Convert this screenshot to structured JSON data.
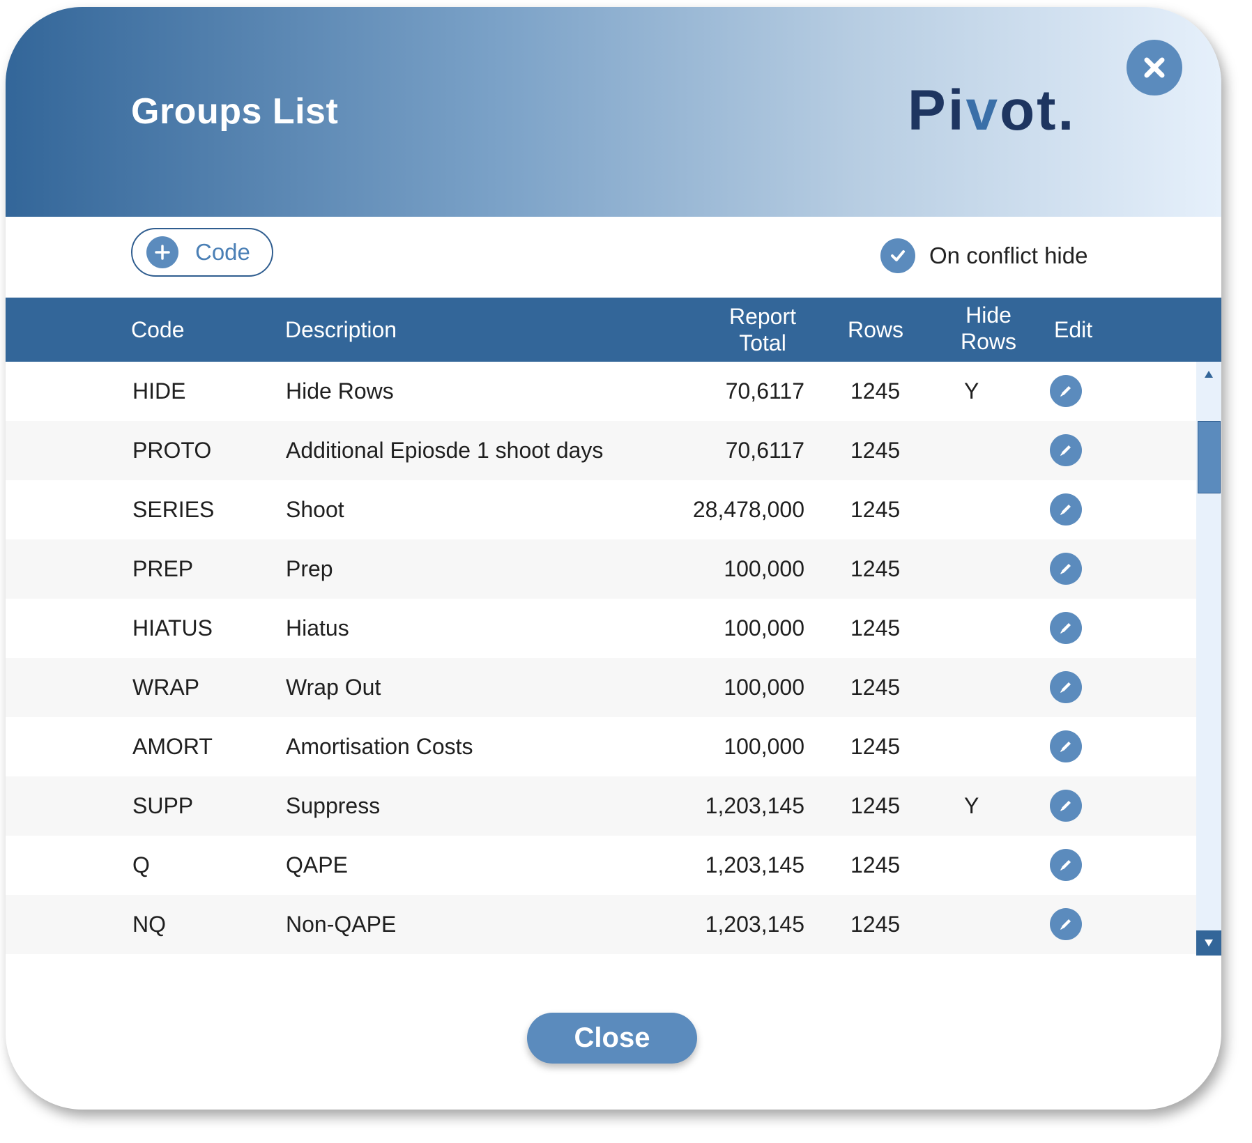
{
  "dialog": {
    "title": "Groups List",
    "logo_prefix": "Pi",
    "logo_v": "v",
    "logo_suffix": "ot.",
    "close_icon": "close-icon"
  },
  "toolbar": {
    "add_code_label": "Code",
    "conflict_label": "On conflict hide",
    "conflict_checked": true
  },
  "table": {
    "headers": {
      "code": "Code",
      "description": "Description",
      "report_total_1": "Report",
      "report_total_2": "Total",
      "rows": "Rows",
      "hide_rows_1": "Hide",
      "hide_rows_2": "Rows",
      "edit": "Edit"
    },
    "rows": [
      {
        "code": "HIDE",
        "description": "Hide Rows",
        "total": "70,6117",
        "rows": "1245",
        "hide": "Y"
      },
      {
        "code": "PROTO",
        "description": "Additional Epiosde 1 shoot days",
        "total": "70,6117",
        "rows": "1245",
        "hide": ""
      },
      {
        "code": "SERIES",
        "description": "Shoot",
        "total": "28,478,000",
        "rows": "1245",
        "hide": ""
      },
      {
        "code": "PREP",
        "description": "Prep",
        "total": "100,000",
        "rows": "1245",
        "hide": ""
      },
      {
        "code": "HIATUS",
        "description": "Hiatus",
        "total": "100,000",
        "rows": "1245",
        "hide": ""
      },
      {
        "code": "WRAP",
        "description": "Wrap Out",
        "total": "100,000",
        "rows": "1245",
        "hide": ""
      },
      {
        "code": "AMORT",
        "description": "Amortisation Costs",
        "total": "100,000",
        "rows": "1245",
        "hide": ""
      },
      {
        "code": "SUPP",
        "description": "Suppress",
        "total": "1,203,145",
        "rows": "1245",
        "hide": "Y"
      },
      {
        "code": "Q",
        "description": "QAPE",
        "total": "1,203,145",
        "rows": "1245",
        "hide": ""
      },
      {
        "code": "NQ",
        "description": "Non-QAPE",
        "total": "1,203,145",
        "rows": "1245",
        "hide": ""
      }
    ]
  },
  "footer": {
    "close_label": "Close"
  },
  "colors": {
    "primary": "#336699",
    "accent": "#5b8bbd",
    "scroll_track": "#e8f1fb"
  }
}
